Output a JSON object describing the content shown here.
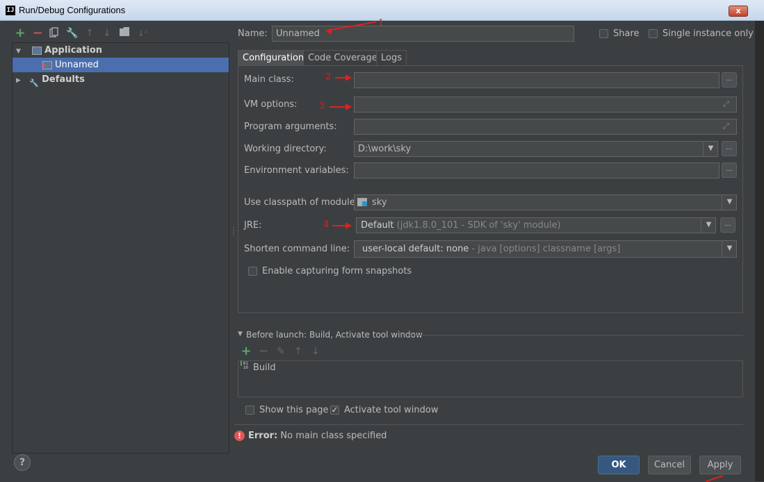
{
  "window": {
    "logo": "IJ",
    "title": "Run/Debug Configurations",
    "close": "x"
  },
  "toolbar_icons": [
    "add-icon",
    "remove-icon",
    "copy-icon",
    "wrench-icon",
    "move-up-icon",
    "move-down-icon",
    "folder-icon",
    "sort-icon"
  ],
  "tree": {
    "items": [
      {
        "label": "Application",
        "expanded": true
      },
      {
        "label": "Unnamed",
        "selected": true
      },
      {
        "label": "Defaults",
        "expanded": false
      }
    ]
  },
  "header": {
    "name_label": "Name:",
    "name_value": "Unnamed",
    "share_label": "Share",
    "single_instance_label": "Single instance only"
  },
  "tabs": [
    {
      "label": "Configuration",
      "active": true
    },
    {
      "label": "Code Coverage"
    },
    {
      "label": "Logs"
    }
  ],
  "config": {
    "main_class_label": "Main class:",
    "main_class_value": "",
    "vm_options_label": "VM options:",
    "vm_options_value": "",
    "program_args_label": "Program arguments:",
    "program_args_value": "",
    "working_dir_label": "Working directory:",
    "working_dir_value": "D:\\work\\sky",
    "env_vars_label": "Environment variables:",
    "env_vars_value": "",
    "classpath_label": "Use classpath of module:",
    "classpath_value": "sky",
    "jre_label": "JRE:",
    "jre_value": "Default",
    "jre_detail": "(jdk1.8.0_101 - SDK of 'sky' module)",
    "shorten_label": "Shorten command line:",
    "shorten_value": "user-local default: none",
    "shorten_detail": "- java [options] classname [args]",
    "capture_label": "Enable capturing form snapshots",
    "dots": "..."
  },
  "before_launch": {
    "title": "Before launch: Build, Activate tool window",
    "toolbar_icons": [
      "add-icon",
      "remove-icon",
      "edit-icon",
      "move-up-icon",
      "move-down-icon"
    ],
    "items": [
      {
        "label": "Build"
      }
    ],
    "show_page_label": "Show this page",
    "activate_label": "Activate tool window"
  },
  "error": {
    "prefix": "Error:",
    "message": "No main class specified"
  },
  "buttons": {
    "help": "?",
    "ok": "OK",
    "cancel": "Cancel",
    "apply": "Apply"
  },
  "annotations": [
    "1",
    "2",
    "3",
    "4"
  ],
  "colors": {
    "background": "#3c3f41",
    "selection": "#4b6eaf",
    "annotation": "#e0201e",
    "error": "#e05555",
    "add": "#59a869"
  }
}
